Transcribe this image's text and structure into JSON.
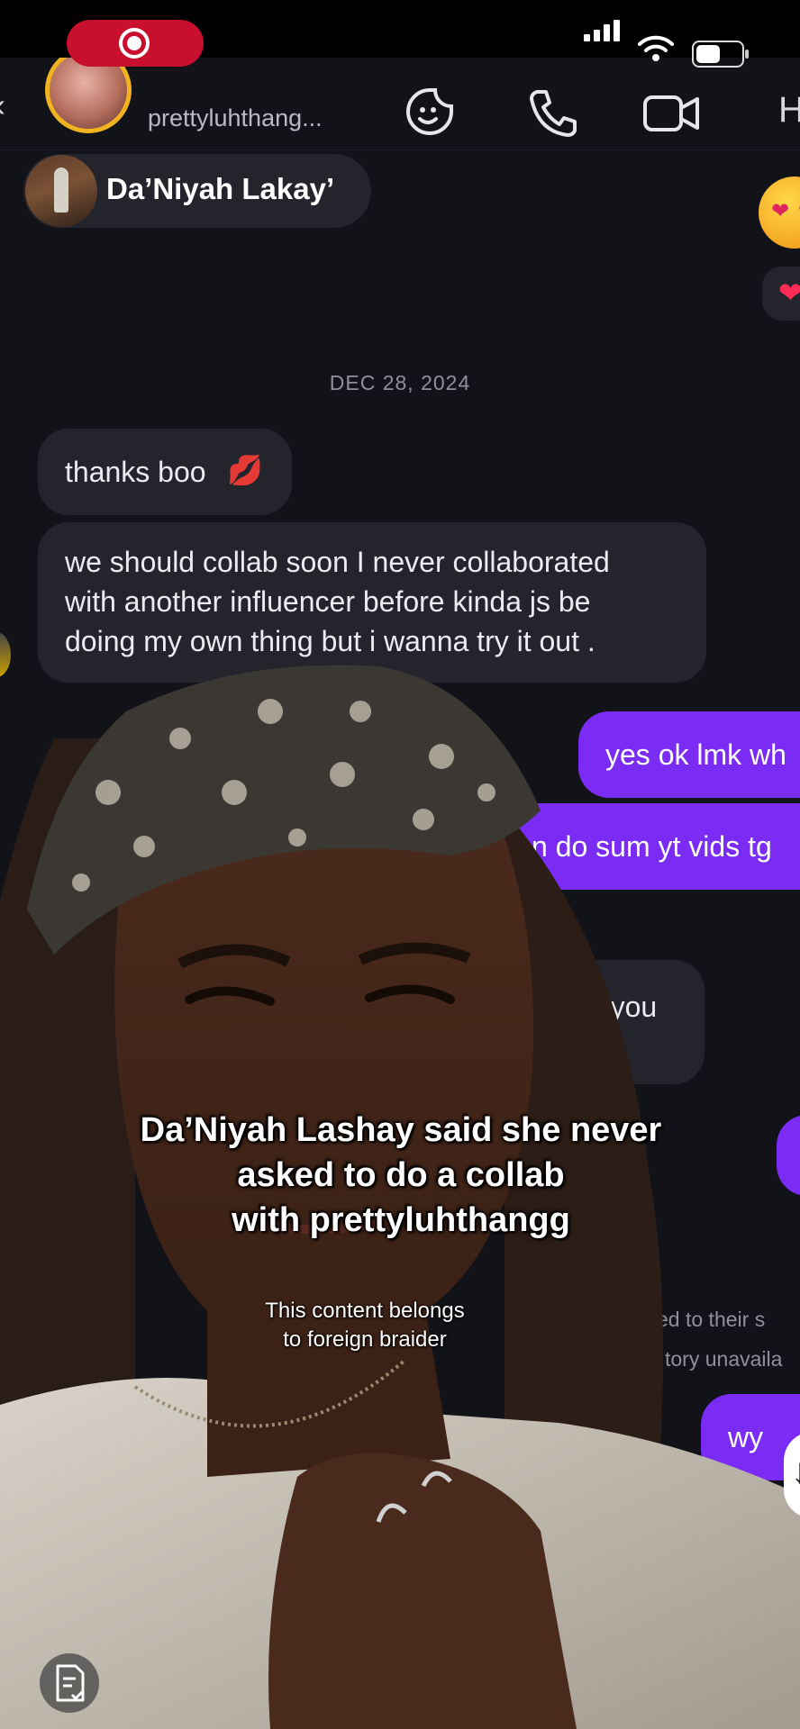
{
  "header": {
    "username": "prettyluhthang...",
    "icons": [
      "back-arrow-icon",
      "sticker-icon",
      "phone-icon",
      "video-icon"
    ],
    "tail_glyph": "H"
  },
  "profile_chip": {
    "name": "Da’Niyah Lakay’"
  },
  "date_label": "DEC 28, 2024",
  "messages": [
    {
      "direction": "in",
      "text": "thanks boo",
      "emoji": "💋"
    },
    {
      "direction": "in",
      "lines": [
        "we should collab soon I never collaborated",
        "with another influencer before kinda js be",
        "doing my own thing but i wanna try it out ."
      ]
    },
    {
      "direction": "out",
      "text": "yes ok lmk wh"
    },
    {
      "direction": "out",
      "text": "n do sum yt vids tg"
    },
    {
      "direction": "in",
      "text": "y so you"
    },
    {
      "direction": "out",
      "text": "wy"
    }
  ],
  "system_notes": [
    "plied to their s",
    "tory unavaila"
  ],
  "caption": {
    "lines": [
      "Da’Niyah Lashay said she never",
      "asked to do a collab",
      "with prettyluhthangg"
    ]
  },
  "credit": {
    "lines": [
      "This content belongs",
      "to foreign braider"
    ]
  },
  "colors": {
    "outgoing_bubble": "#7a2cf5",
    "incoming_bubble": "#23242c",
    "background": "#121219",
    "record_pill": "#c8102e"
  }
}
